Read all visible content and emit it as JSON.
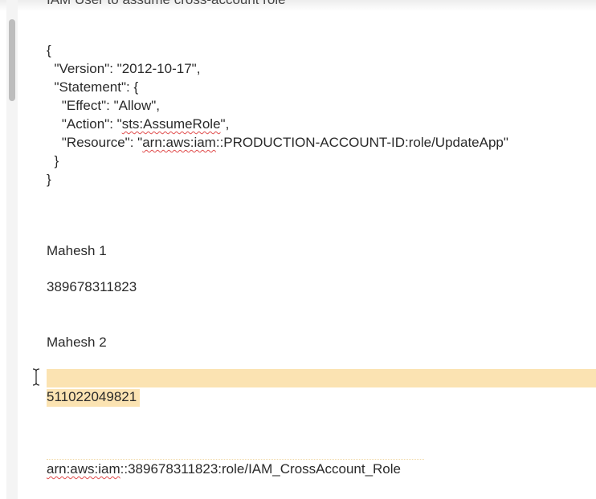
{
  "document": {
    "cut_off_heading": "IAM User to assume cross-account role",
    "json_lines": [
      "{",
      "  \"Version\": \"2012-10-17\",",
      "  \"Statement\": {",
      "    \"Effect\": \"Allow\",",
      "    \"Action\": \"",
      "sts:AssumeRole",
      "\",",
      "    \"Resource\": \"",
      "arn:aws:iam",
      "::PRODUCTION-ACCOUNT-ID:role/UpdateApp\"",
      "  }",
      "}"
    ],
    "mahesh1_label": "Mahesh 1",
    "mahesh1_account": "389678311823",
    "mahesh2_label": "Mahesh 2",
    "mahesh2_account": "511022049821",
    "role_arn_prefix": "arn:aws:iam",
    "role_arn_rest": "::389678311823:role/IAM_CrossAccount_Role"
  },
  "colors": {
    "highlight": "#fbe3b2",
    "spellcheck": "#e04b4b"
  },
  "icons": {
    "cursor": "text-cursor-icon"
  }
}
